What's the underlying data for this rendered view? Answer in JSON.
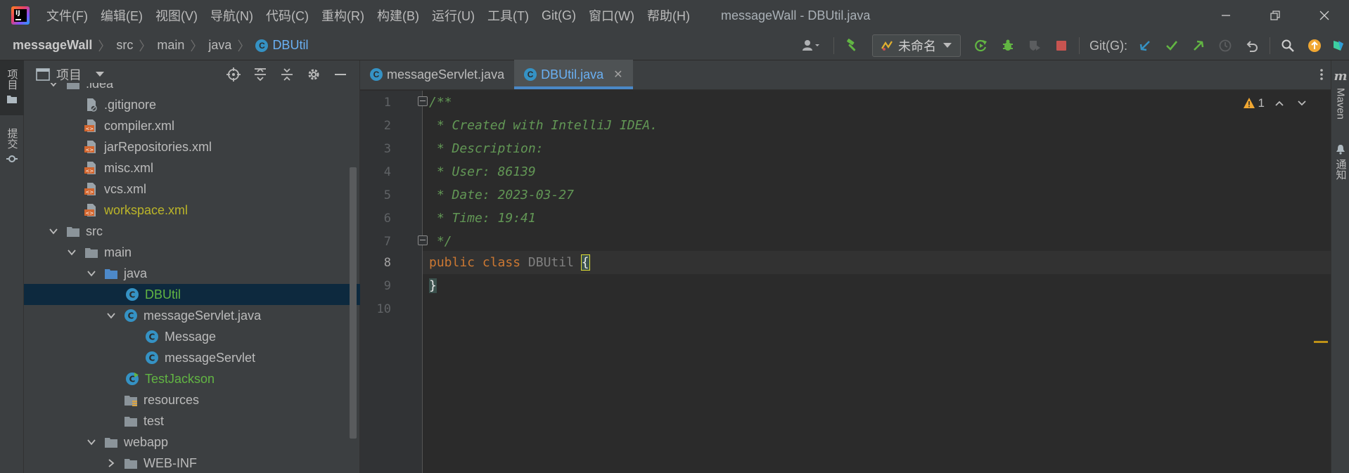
{
  "menubar": {
    "items": [
      "文件(F)",
      "编辑(E)",
      "视图(V)",
      "导航(N)",
      "代码(C)",
      "重构(R)",
      "构建(B)",
      "运行(U)",
      "工具(T)",
      "Git(G)",
      "窗口(W)",
      "帮助(H)"
    ],
    "window_title": "messageWall - DBUtil.java"
  },
  "breadcrumb": {
    "project": "messageWall",
    "parts": [
      "src",
      "main",
      "java"
    ],
    "current": "DBUtil"
  },
  "toolbar": {
    "run_config": "未命名",
    "git_label": "Git(G):"
  },
  "left_strip": {
    "project_tab": "项目",
    "commit_tab": "提交"
  },
  "project_panel": {
    "title": "项目"
  },
  "tree": [
    {
      "label": ".idea"
    },
    {
      "label": ".gitignore"
    },
    {
      "label": "compiler.xml"
    },
    {
      "label": "jarRepositories.xml"
    },
    {
      "label": "misc.xml"
    },
    {
      "label": "vcs.xml"
    },
    {
      "label": "workspace.xml"
    },
    {
      "label": "src"
    },
    {
      "label": "main"
    },
    {
      "label": "java"
    },
    {
      "label": "DBUtil"
    },
    {
      "label": "messageServlet.java"
    },
    {
      "label": "Message"
    },
    {
      "label": "messageServlet"
    },
    {
      "label": "TestJackson"
    },
    {
      "label": "resources"
    },
    {
      "label": "test"
    },
    {
      "label": "webapp"
    },
    {
      "label": "WEB-INF"
    }
  ],
  "editor": {
    "tabs": [
      {
        "label": "messageServlet.java"
      },
      {
        "label": "DBUtil.java"
      }
    ],
    "warning_count": "1",
    "line_numbers": [
      "1",
      "2",
      "3",
      "4",
      "5",
      "6",
      "7",
      "8",
      "9",
      "10"
    ],
    "code": {
      "l1": "/**",
      "l2": " * Created with IntelliJ IDEA.",
      "l3": " * Description:",
      "l4": " * User: 86139",
      "l5": " * Date: 2023-03-27",
      "l6": " * Time: 19:41",
      "l7": " */",
      "l8_kw1": "public",
      "l8_kw2": "class",
      "l8_name": "DBUtil",
      "l8_brace": "{",
      "l9_brace": "}"
    }
  },
  "right_strip": {
    "maven": "Maven",
    "notifications": "通知"
  },
  "colors": {
    "accent": "#4a88c7",
    "doc_comment": "#629755",
    "keyword": "#cc7832",
    "selection": "#0d293e"
  }
}
